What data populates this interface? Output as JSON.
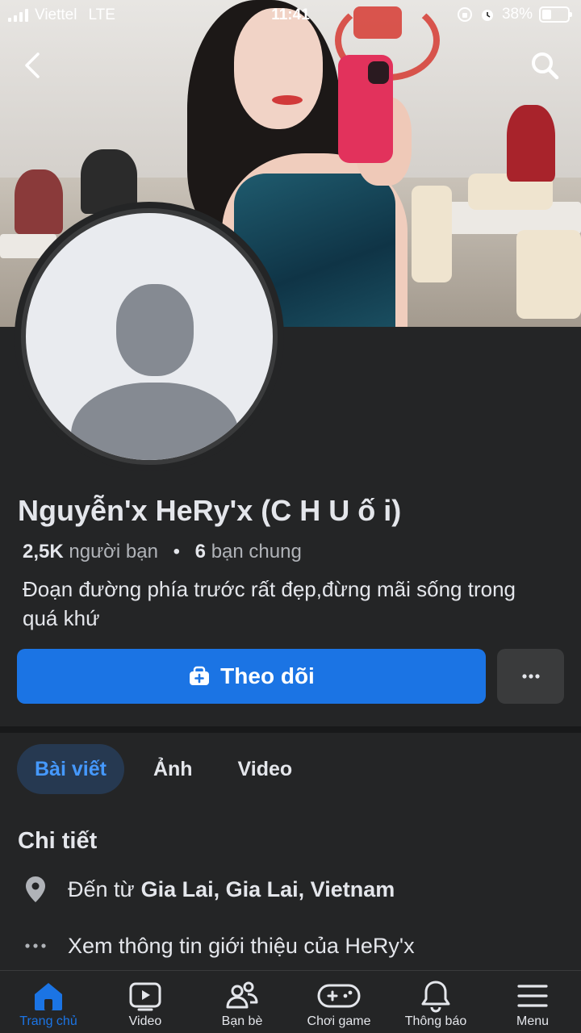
{
  "status_bar": {
    "carrier": "Viettel",
    "network": "LTE",
    "time": "11:41",
    "battery_percent": "38%",
    "battery_level": 0.38
  },
  "header": {
    "back_icon": "chevron-left-icon",
    "search_icon": "search-icon"
  },
  "profile": {
    "name": "Nguyễn'x HeRy'x (C H U ố i)",
    "friends_count": "2,5K",
    "friends_label": "người bạn",
    "separator": "•",
    "mutual_count": "6",
    "mutual_label": "bạn chung",
    "bio": "Đoạn đường phía trước rất đẹp,đừng mãi sống trong quá khứ"
  },
  "actions": {
    "follow_label": "Theo dõi",
    "more_icon": "ellipsis-icon"
  },
  "tabs": [
    {
      "label": "Bài viết",
      "active": true
    },
    {
      "label": "Ảnh",
      "active": false
    },
    {
      "label": "Video",
      "active": false
    }
  ],
  "details": {
    "title": "Chi tiết",
    "hometown_prefix": "Đến từ",
    "hometown_value": "Gia Lai, Gia Lai, Vietnam",
    "see_about": "Xem thông tin giới thiệu của HeRy'x"
  },
  "bottom_nav": [
    {
      "label": "Trang chủ",
      "icon": "home-icon",
      "active": true
    },
    {
      "label": "Video",
      "icon": "video-icon",
      "active": false
    },
    {
      "label": "Bạn bè",
      "icon": "friends-icon",
      "active": false
    },
    {
      "label": "Chơi game",
      "icon": "gamepad-icon",
      "active": false
    },
    {
      "label": "Thông báo",
      "icon": "bell-icon",
      "active": false
    },
    {
      "label": "Menu",
      "icon": "menu-icon",
      "active": false
    }
  ],
  "colors": {
    "background": "#242526",
    "accent": "#1b74e4",
    "tab_active_bg": "#263951",
    "tab_active_text": "#4599ff",
    "secondary_button": "#3a3b3c"
  }
}
